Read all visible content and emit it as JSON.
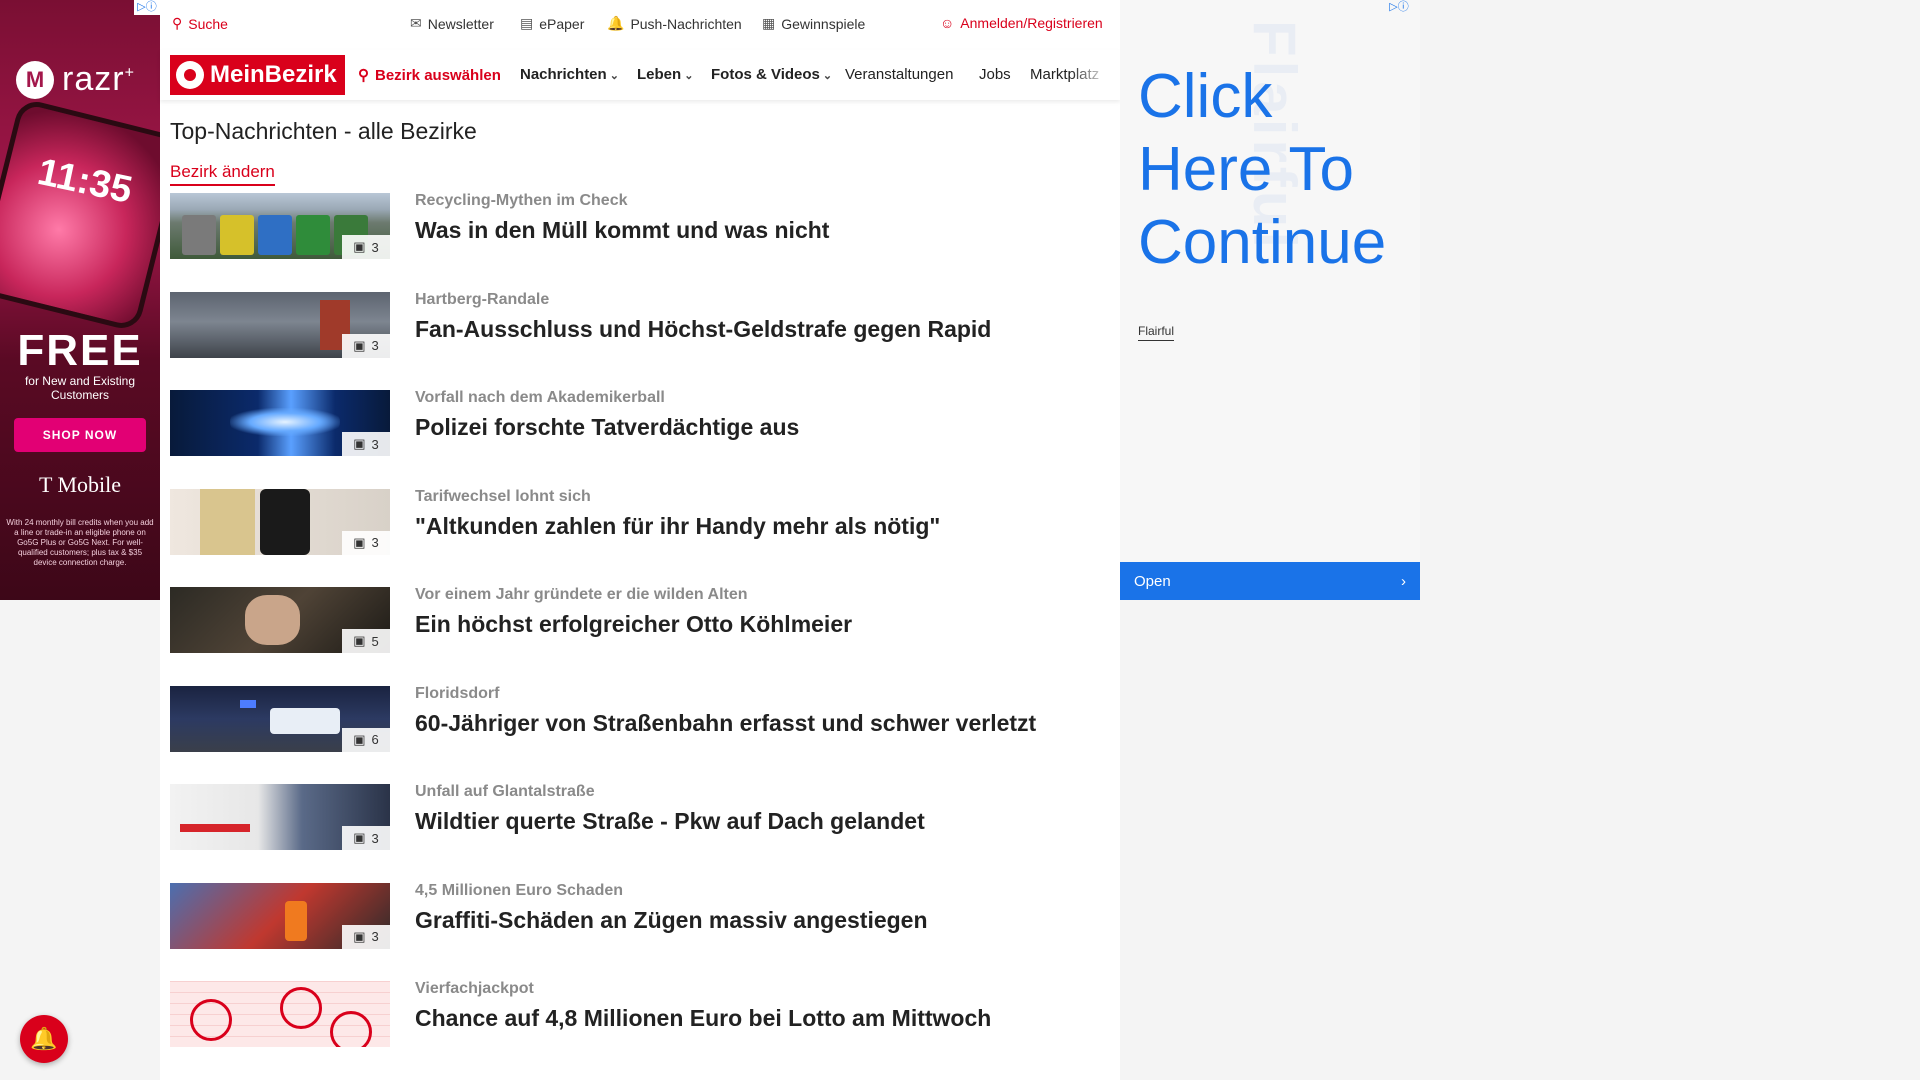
{
  "ad_left": {
    "choices": "▷ⓘ",
    "brand": "razr",
    "brand_sup": "+",
    "phone_time": "11:35",
    "headline": "FREE",
    "subline": "for New and Existing Customers",
    "cta": "SHOP NOW",
    "carrier": "T Mobile",
    "fine_print": "With 24 monthly bill credits when you add a line or trade-in an eligible phone on Go5G Plus or Go5G Next. For well-qualified customers; plus tax & $35 device connection charge."
  },
  "utility": {
    "search": "Suche",
    "newsletter": "Newsletter",
    "epaper": "ePaper",
    "push": "Push-Nachrichten",
    "games": "Gewinnspiele",
    "login": "Anmelden/Registrieren"
  },
  "nav": {
    "logo": "MeinBezirk",
    "district": "Bezirk auswählen",
    "items": [
      {
        "label": "Nachrichten",
        "dropdown": true
      },
      {
        "label": "Leben",
        "dropdown": true
      },
      {
        "label": "Fotos & Videos",
        "dropdown": true
      },
      {
        "label": "Veranstaltungen",
        "dropdown": false
      },
      {
        "label": "Jobs",
        "dropdown": false
      },
      {
        "label": "Marktplatz",
        "dropdown": false
      }
    ]
  },
  "page": {
    "title": "Top-Nachrichten - alle Bezirke",
    "change_district": "Bezirk ändern"
  },
  "articles": [
    {
      "kicker": "Recycling-Mythen im Check",
      "headline": "Was in den Müll kommt und was nicht",
      "count": "3"
    },
    {
      "kicker": "Hartberg-Randale",
      "headline": "Fan-Ausschluss und Höchst-Geldstrafe gegen Rapid",
      "count": "3"
    },
    {
      "kicker": "Vorfall nach dem Akademikerball",
      "headline": "Polizei forschte Tatverdächtige aus",
      "count": "3"
    },
    {
      "kicker": "Tarifwechsel lohnt sich",
      "headline": "\"Altkunden zahlen für ihr Handy mehr als nötig\"",
      "count": "3"
    },
    {
      "kicker": "Vor einem Jahr gründete er die wilden Alten",
      "headline": "Ein höchst erfolgreicher Otto Köhlmeier",
      "count": "5"
    },
    {
      "kicker": "Floridsdorf",
      "headline": "60-Jähriger von Straßenbahn erfasst und schwer verletzt",
      "count": "6"
    },
    {
      "kicker": "Unfall auf Glantalstraße",
      "headline": "Wildtier querte Straße - Pkw auf Dach gelandet",
      "count": "3"
    },
    {
      "kicker": "4,5 Millionen Euro Schaden",
      "headline": "Graffiti-Schäden an Zügen massiv angestiegen",
      "count": "3"
    },
    {
      "kicker": "Vierfachjackpot",
      "headline": "Chance auf 4,8 Millionen Euro bei Lotto am Mittwoch",
      "count": ""
    }
  ],
  "ad_right": {
    "choices": "▷ⓘ",
    "watermark": "Flairful",
    "cta_lines": [
      "Click",
      "Here To",
      "Continue"
    ],
    "sponsor": "Flairful",
    "open": "Open"
  },
  "colors": {
    "brand": "#d9001b",
    "ad_blue": "#1a73e8"
  }
}
